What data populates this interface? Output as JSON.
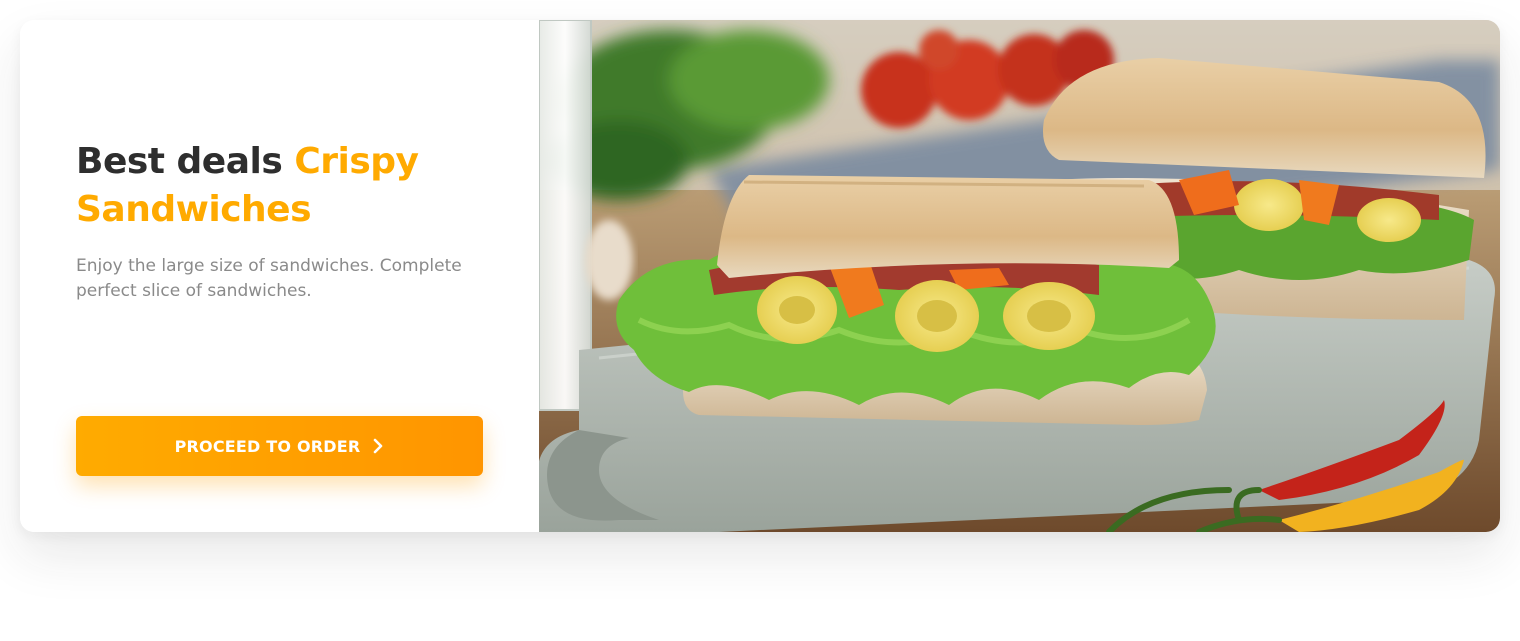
{
  "promo": {
    "headline_main": "Best deals ",
    "headline_accent": "Crispy Sandwiches",
    "description": "Enjoy the large size of sandwiches. Complete perfect slice of sandwiches.",
    "cta_label": "PROCEED TO ORDER",
    "cta_icon": "chevron-right-icon"
  },
  "colors": {
    "accent": "#ffaa00",
    "heading": "#2e2e2e",
    "body_text": "#8a8a8a",
    "button_start": "#ffab00",
    "button_end": "#ff9500"
  },
  "image": {
    "subject": "sandwiches-photo"
  }
}
